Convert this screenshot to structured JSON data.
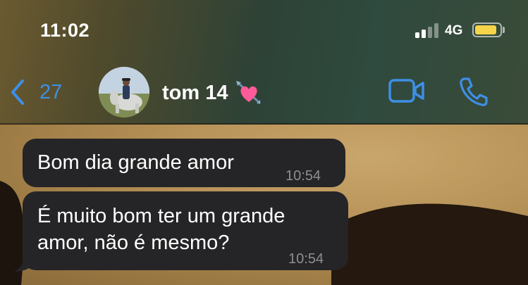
{
  "status_bar": {
    "time": "11:02",
    "network": "4G",
    "battery_color": "#f6d44a"
  },
  "nav": {
    "back_count": "27",
    "contact_name": "tom 14",
    "contact_emoji": "heart-with-arrow-icon",
    "accent_color": "#3e8fe6"
  },
  "messages": [
    {
      "text": "Bom dia grande amor",
      "time": "10:54",
      "direction": "incoming"
    },
    {
      "text_line1": "É muito bom ter um grande",
      "text_line2": "amor, não é mesmo?",
      "time": "10:54",
      "direction": "incoming"
    }
  ]
}
